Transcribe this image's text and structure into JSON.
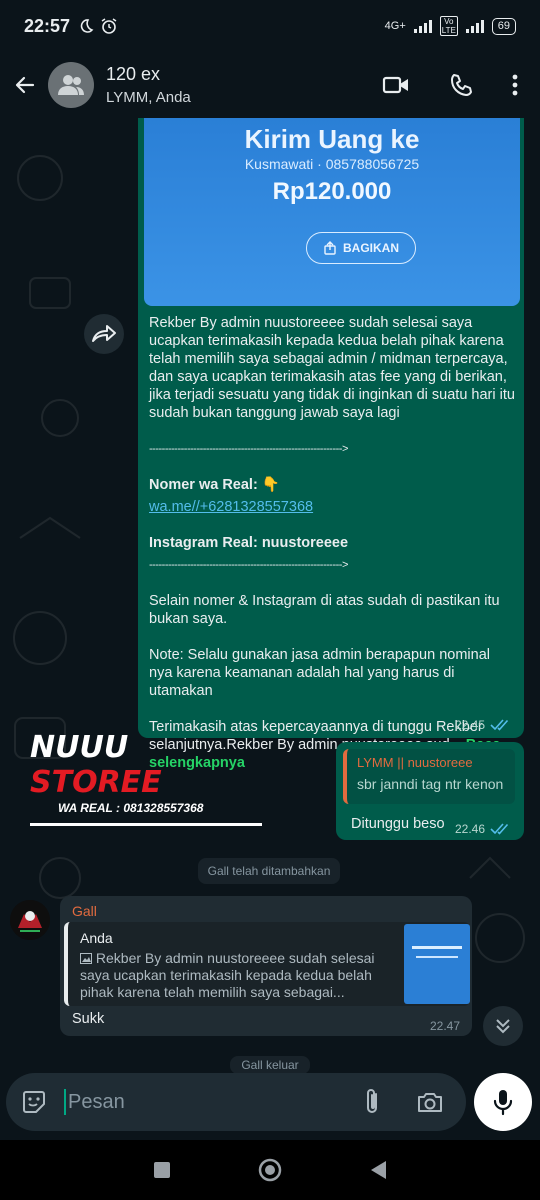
{
  "status_bar": {
    "time": "22:57",
    "network": "4G+",
    "volte": "Vo LTE",
    "battery": "69"
  },
  "header": {
    "title": "120 ex",
    "subtitle": "LYMM, Anda"
  },
  "image_message": {
    "heading": "Kirim Uang ke",
    "recipient": "Kusmawati · 085788056725",
    "amount": "Rp120.000",
    "share_label": "BAGIKAN"
  },
  "forwarded_message": {
    "para1": "Rekber By admin nuustoreeee sudah selesai saya ucapkan terimakasih kepada kedua belah pihak karena telah memilih saya sebagai admin / midman terpercaya, dan saya ucapkan terimakasih atas fee yang di berikan, jika terjadi sesuatu yang tidak di inginkan di suatu hari itu sudah bukan tanggung jawab saya lagi",
    "divider1": "------------------------------------------------------------->",
    "wa_label": "Nomer wa Real: 👇",
    "wa_link": "wa.me//+6281328557368",
    "ig_label": "Instagram Real: nuustoreeee",
    "divider2": "------------------------------------------------------------->",
    "para2": "Selain nomer & Instagram di atas sudah di pastikan itu bukan saya.",
    "para3": "Note: Selalu gunakan jasa admin berapapun nominal nya karena keamanan adalah hal yang harus di utamakan",
    "para4": "Terimakasih atas kepercayaannya di tunggu Rekber selanjutnya.Rekber By admin nuustoreeee sud...",
    "read_more": "Baca selengkapnya",
    "time": "22.45"
  },
  "watermark": {
    "brand_a": "NUUU",
    "brand_b": "STOREE",
    "wa": "WA REAL : 081328557368"
  },
  "reply_message": {
    "quoted_name": "LYMM || nuustoreee",
    "quoted_text": "sbr janndi tag ntr kenon",
    "body": "Ditunggu beso",
    "time": "22.46"
  },
  "system_notices": {
    "added": "Gall telah ditambahkan",
    "left": "Gall keluar"
  },
  "incoming_message": {
    "sender": "Gall",
    "quoted_name": "Anda",
    "quoted_text": "Rekber By admin nuustoreeee sudah selesai saya ucapkan terimakasih kepada kedua belah pihak karena telah memilih saya sebagai...",
    "body": "Sukk",
    "time": "22.47"
  },
  "composer": {
    "placeholder": "Pesan"
  },
  "colors": {
    "background": "#0b141a",
    "outgoing_bubble": "#005c4b",
    "incoming_bubble": "#202c33",
    "accent": "#00a884",
    "link": "#53bdeb",
    "sender_name": "#e26b3f",
    "read_ticks": "#53bdeb"
  }
}
